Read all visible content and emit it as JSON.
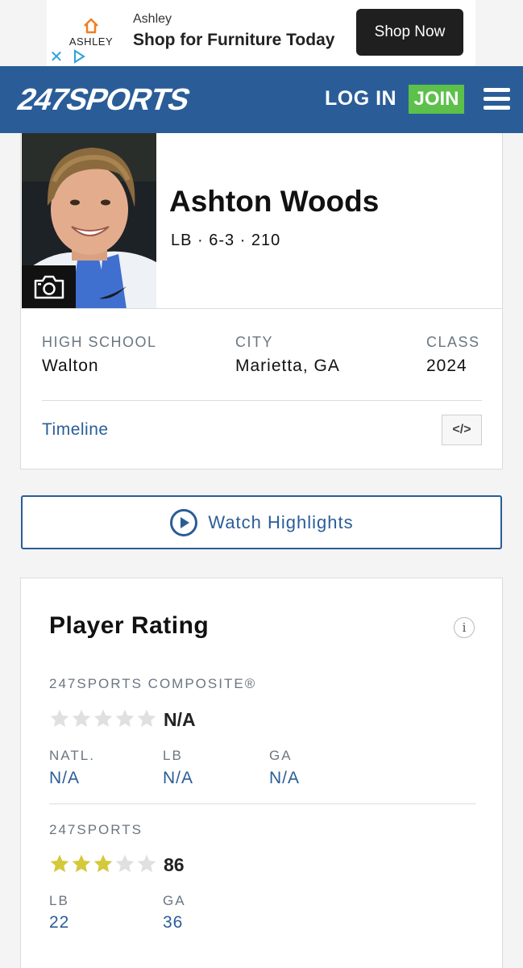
{
  "ad": {
    "brand_word": "ASHLEY",
    "advertiser": "Ashley",
    "headline": "Shop for Furniture Today",
    "cta": "Shop Now",
    "close": "✕"
  },
  "header": {
    "logo_text": "247SPORTS",
    "login": "LOG IN",
    "join": "JOIN"
  },
  "player": {
    "name": "Ashton Woods",
    "meta": "LB · 6-3 · 210",
    "details": [
      {
        "label": "HIGH SCHOOL",
        "value": "Walton"
      },
      {
        "label": "CITY",
        "value": "Marietta, GA"
      },
      {
        "label": "CLASS",
        "value": "2024"
      }
    ],
    "timeline": "Timeline",
    "embed_icon": "</>"
  },
  "watch": {
    "label": "Watch Highlights"
  },
  "rating": {
    "title": "Player Rating",
    "info_icon": "i",
    "composite": {
      "label": "247SPORTS COMPOSITE®",
      "stars_filled": 0,
      "stars_total": 5,
      "score": "N/A",
      "ranks": [
        {
          "label": "NATL.",
          "value": "N/A"
        },
        {
          "label": "LB",
          "value": "N/A"
        },
        {
          "label": "GA",
          "value": "N/A"
        }
      ]
    },
    "sports247": {
      "label": "247SPORTS",
      "stars_filled": 3,
      "stars_total": 5,
      "score": "86",
      "ranks": [
        {
          "label": "LB",
          "value": "22"
        },
        {
          "label": "GA",
          "value": "36"
        }
      ]
    }
  },
  "colors": {
    "brand_blue": "#2a5d98",
    "join_green": "#5cc04b",
    "star_gold": "#d4c93a",
    "star_empty": "#e0e0e0"
  }
}
